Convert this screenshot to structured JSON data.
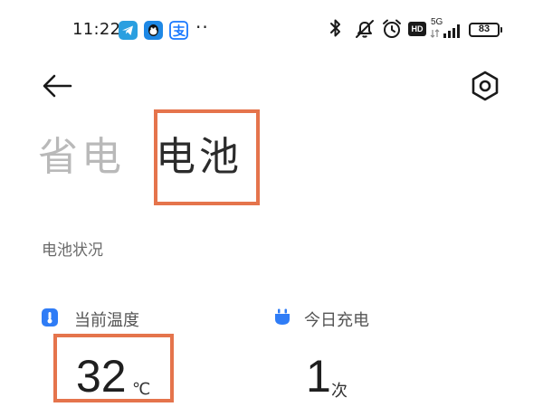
{
  "status_bar": {
    "time": "11:22",
    "more_indicator": "··",
    "network_label": "5G",
    "hd_label": "HD",
    "battery_level": "83",
    "icons": [
      "telegram-icon",
      "qq-icon",
      "alipay-icon",
      "bluetooth-icon",
      "mute-icon",
      "alarm-icon",
      "hd-icon",
      "signal-icon",
      "battery-icon"
    ]
  },
  "header": {
    "back_icon": "back-arrow-icon",
    "settings_icon": "settings-hexagon-icon"
  },
  "tabs": [
    {
      "label": "省电",
      "active": false
    },
    {
      "label": "电池",
      "active": true
    }
  ],
  "section": {
    "title": "电池状况"
  },
  "metrics": {
    "temperature": {
      "label": "当前温度",
      "value": "32",
      "unit": "℃",
      "icon": "thermometer-icon",
      "icon_color": "#2f7cf6"
    },
    "charges_today": {
      "label": "今日充电",
      "value": "1",
      "unit": "次",
      "icon": "plug-icon",
      "icon_color": "#2f7cf6"
    }
  },
  "colors": {
    "highlight": "#e5744c",
    "accent": "#2f7cf6",
    "inactive_tab": "#b9b9b9",
    "active_tab": "#2b2b2b"
  }
}
